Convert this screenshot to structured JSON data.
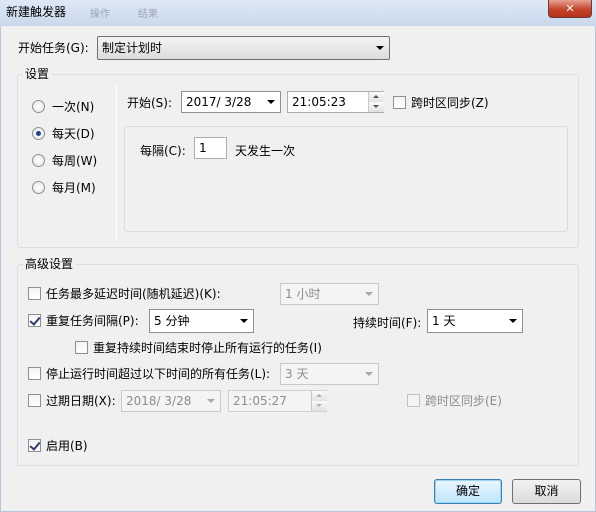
{
  "window": {
    "title": "新建触发器",
    "close_glyph": "✕",
    "background_tab_1": "操作",
    "background_tab_2": "结果"
  },
  "begin_task": {
    "label": "开始任务(G):",
    "value": "制定计划时"
  },
  "settings": {
    "group_label": "设置",
    "schedule_options": [
      {
        "label": "一次(N)",
        "selected": false
      },
      {
        "label": "每天(D)",
        "selected": true
      },
      {
        "label": "每周(W)",
        "selected": false
      },
      {
        "label": "每月(M)",
        "selected": false
      }
    ],
    "start_label": "开始(S):",
    "start_date": "2017/  3/28",
    "start_time": "21:05:23",
    "sync_timezone": {
      "label": "跨时区同步(Z)",
      "checked": false
    },
    "recur_label": "每隔(C):",
    "recur_value": "1",
    "recur_suffix": "天发生一次"
  },
  "advanced": {
    "group_label": "高级设置",
    "delay": {
      "label": "任务最多延迟时间(随机延迟)(K):",
      "checked": false,
      "value": "1 小时"
    },
    "repeat": {
      "label": "重复任务间隔(P):",
      "checked": true,
      "value": "5 分钟",
      "duration_label": "持续时间(F):",
      "duration_value": "1 天"
    },
    "stop_at_end": {
      "label": "重复持续时间结束时停止所有运行的任务(I)",
      "checked": false
    },
    "stop_if_longer": {
      "label": "停止运行时间超过以下时间的所有任务(L):",
      "checked": false,
      "value": "3 天"
    },
    "expire": {
      "label": "过期日期(X):",
      "checked": false,
      "date": "2018/  3/28",
      "time": "21:05:27",
      "sync_label": "跨时区同步(E)",
      "sync_checked": false
    },
    "enabled": {
      "label": "启用(B)",
      "checked": true
    }
  },
  "buttons": {
    "ok": "确定",
    "cancel": "取消"
  },
  "colors": {
    "title_bar": "#dfe9f5",
    "dialog_bg": "#f0f0f0",
    "close_button": "#c4442b",
    "default_button": "#bee6fd"
  }
}
